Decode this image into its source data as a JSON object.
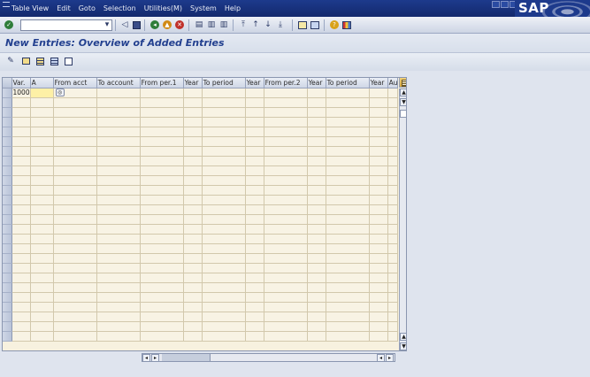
{
  "menubar": {
    "items": [
      "Table View",
      "Edit",
      "Goto",
      "Selection",
      "Utilities(M)",
      "System",
      "Help"
    ],
    "logo": "SAP"
  },
  "toolbar": {
    "command_value": "",
    "icons": [
      "enter-icon",
      "dropdown-icon",
      "back-arrow-icon",
      "save-icon",
      "back-icon",
      "exit-icon",
      "cancel-icon",
      "print-icon",
      "find-icon",
      "find-next-icon",
      "first-page-icon",
      "previous-page-icon",
      "next-page-icon",
      "last-page-icon",
      "new-session-icon",
      "shortcut-icon",
      "help-icon",
      "customize-layout-icon"
    ],
    "accent_colors": {
      "back": "#2f7d3a",
      "exit": "#d18a14",
      "cancel": "#c0302a"
    }
  },
  "page": {
    "title": "New Entries: Overview of Added Entries"
  },
  "app_toolbar": {
    "icons": [
      "change-icon",
      "copy-as-icon",
      "select-all-icon",
      "select-block-icon",
      "deselect-all-icon"
    ]
  },
  "table": {
    "columns": [
      "Var.",
      "A",
      "From acct",
      "To account",
      "From per.1",
      "Year",
      "To period",
      "Year",
      "From per.2",
      "Year",
      "To period",
      "Year",
      "Au"
    ],
    "rows": [
      [
        "1000",
        "",
        "",
        "",
        "",
        "",
        "",
        "",
        "",
        "",
        "",
        "",
        ""
      ]
    ]
  }
}
